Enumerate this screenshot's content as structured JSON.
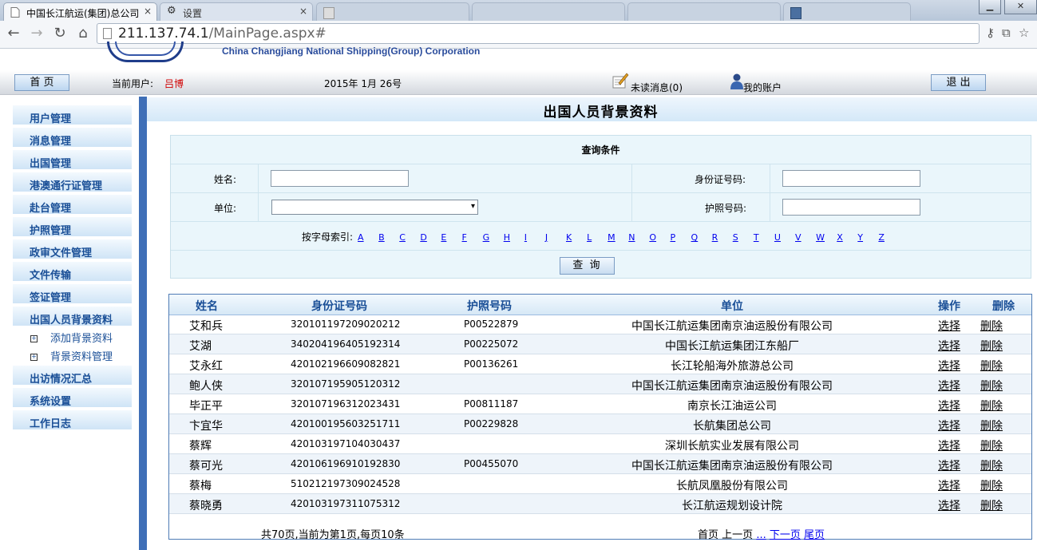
{
  "browser": {
    "tabs": [
      {
        "title": "中国长江航运(集团)总公司",
        "close": "×"
      },
      {
        "title": "设置",
        "close": "×"
      }
    ],
    "url_host": "211.137.74.1",
    "url_path": "/MainPage.aspx#"
  },
  "banner": {
    "corp_name_en": "China Changjiang National Shipping(Group) Corporation"
  },
  "userbar": {
    "home_label": "首 页",
    "current_user_label": "当前用户:",
    "current_user": "吕博",
    "date": "2015年 1月 26号",
    "unread_messages": "未读消息(0)",
    "my_account": "我的账户",
    "logout_label": "退 出"
  },
  "sidebar": {
    "items": [
      "用户管理",
      "消息管理",
      "出国管理",
      "港澳通行证管理",
      "赴台管理",
      "护照管理",
      "政审文件管理",
      "文件传输",
      "签证管理",
      "出国人员背景资料"
    ],
    "subitems": [
      "添加背景资料",
      "背景资料管理"
    ],
    "items_after": [
      "出访情况汇总",
      "系统设置",
      "工作日志"
    ],
    "expand_glyph": "+"
  },
  "main": {
    "title": "出国人员背景资料",
    "query": {
      "heading": "查询条件",
      "name_label": "姓名:",
      "id_label": "身份证号码:",
      "unit_label": "单位:",
      "passport_label": "护照号码:",
      "alpha_label": "按字母索引:",
      "letters": [
        "A",
        "B",
        "C",
        "D",
        "E",
        "F",
        "G",
        "H",
        "I",
        "J",
        "K",
        "L",
        "M",
        "N",
        "O",
        "P",
        "Q",
        "R",
        "S",
        "T",
        "U",
        "V",
        "W",
        "X",
        "Y",
        "Z"
      ],
      "search_label": "查 询"
    },
    "table": {
      "headers": [
        "姓名",
        "身份证号码",
        "护照号码",
        "单位",
        "操作",
        "删除"
      ],
      "rows": [
        {
          "name": "艾和兵",
          "id": "320101197209020212",
          "passport": "P00522879",
          "unit": "中国长江航运集团南京油运股份有限公司"
        },
        {
          "name": "艾湖",
          "id": "340204196405192314",
          "passport": "P00225072",
          "unit": "中国长江航运集团江东船厂"
        },
        {
          "name": "艾永红",
          "id": "420102196609082821",
          "passport": "P00136261",
          "unit": "长江轮船海外旅游总公司"
        },
        {
          "name": "鲍人侠",
          "id": "320107195905120312",
          "passport": "",
          "unit": "中国长江航运集团南京油运股份有限公司"
        },
        {
          "name": "毕正平",
          "id": "320107196312023431",
          "passport": "P00811187",
          "unit": "南京长江油运公司"
        },
        {
          "name": "卞宜华",
          "id": "420100195603251711",
          "passport": "P00229828",
          "unit": "长航集团总公司"
        },
        {
          "name": "蔡辉",
          "id": "420103197104030437",
          "passport": "",
          "unit": "深圳长航实业发展有限公司"
        },
        {
          "name": "蔡可光",
          "id": "420106196910192830",
          "passport": "P00455070",
          "unit": "中国长江航运集团南京油运股份有限公司"
        },
        {
          "name": "蔡梅",
          "id": "510212197309024528",
          "passport": "",
          "unit": "长航凤凰股份有限公司"
        },
        {
          "name": "蔡晓勇",
          "id": "420103197311075312",
          "passport": "",
          "unit": "长江航运规划设计院"
        }
      ],
      "select_label": "选择",
      "delete_label": "删除"
    },
    "pager": {
      "summary": "共70页,当前为第1页,每页10条",
      "first": "首页",
      "prev": "上一页",
      "ellipsis": "...",
      "next": "下一页",
      "last": "尾页"
    }
  }
}
